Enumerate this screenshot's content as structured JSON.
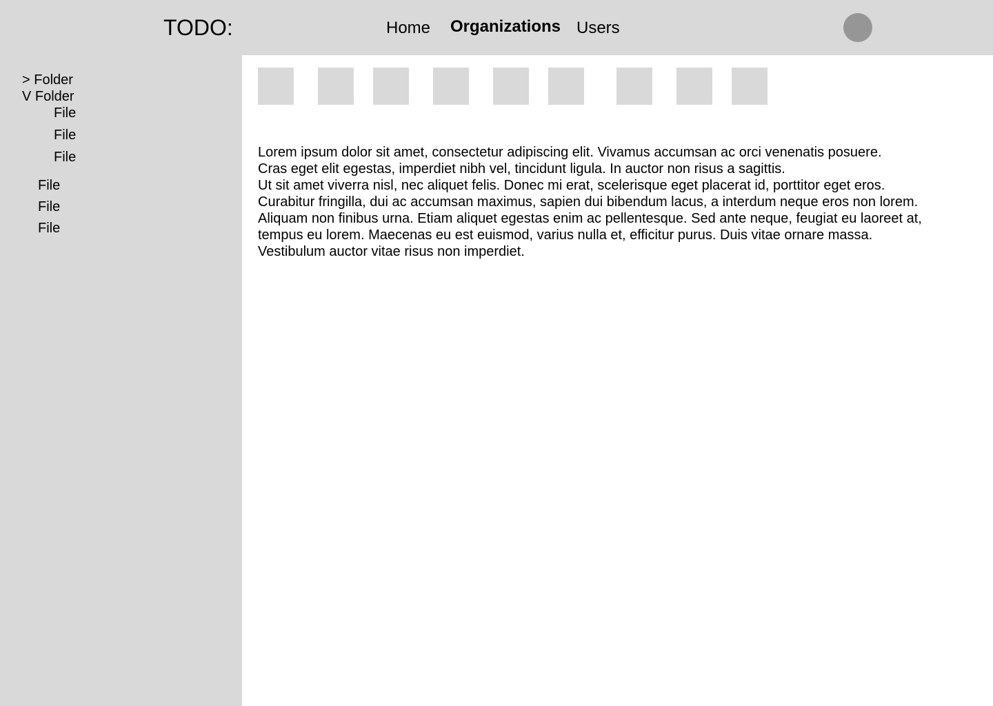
{
  "header": {
    "title": "TODO:",
    "nav": [
      {
        "label": "Home",
        "active": false
      },
      {
        "label": "Organizations",
        "active": true
      },
      {
        "label": "Users",
        "active": false
      }
    ],
    "avatar_color": "#969696"
  },
  "sidebar": {
    "items": [
      {
        "label": "> Folder"
      },
      {
        "label": "V Folder"
      },
      {
        "label": "File"
      },
      {
        "label": "File"
      },
      {
        "label": "File"
      },
      {
        "label": "File"
      },
      {
        "label": "File"
      },
      {
        "label": "File"
      }
    ]
  },
  "content": {
    "lines": [
      "Lorem ipsum dolor sit amet, consectetur adipiscing elit. Vivamus accumsan ac orci venenatis posuere.",
      "Cras eget elit egestas, imperdiet nibh vel, tincidunt ligula. In auctor non risus a sagittis.",
      "Ut sit amet viverra nisl, nec aliquet felis. Donec mi erat, scelerisque eget placerat id, porttitor eget eros.",
      "Curabitur fringilla, dui ac accumsan maximus, sapien dui bibendum lacus, a interdum neque eros non lorem.",
      "Aliquam non finibus urna. Etiam aliquet egestas enim ac pellentesque. Sed ante neque, feugiat eu laoreet at,",
      "tempus eu lorem. Maecenas eu est euismod, varius nulla et, efficitur purus. Duis vitae ornare massa.",
      "Vestibulum auctor vitae risus non imperdiet."
    ]
  },
  "colors": {
    "panel": "#d9d9d9",
    "background": "#ffffff",
    "avatar": "#969696"
  }
}
